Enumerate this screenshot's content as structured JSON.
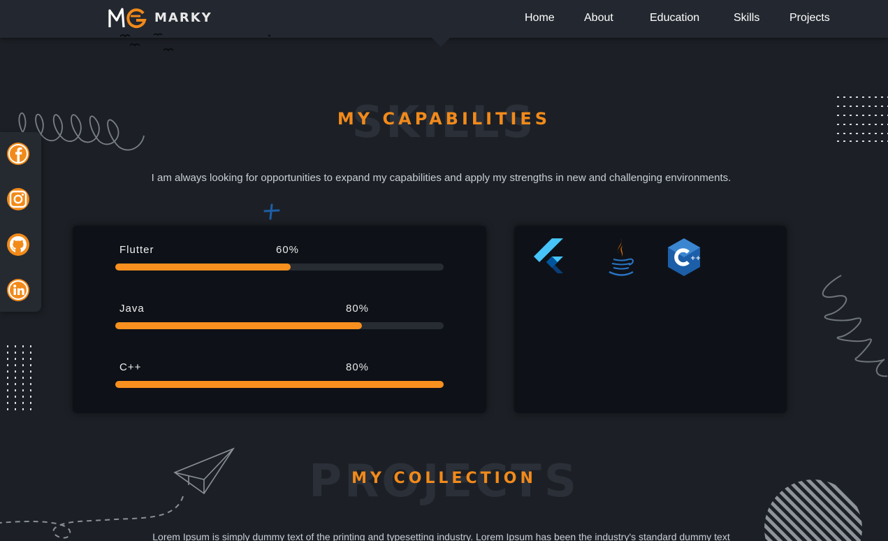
{
  "brand": {
    "name": "MARKY",
    "logo_letters": "MG"
  },
  "nav": {
    "items": [
      "Home",
      "About",
      "Education",
      "Skills",
      "Projects"
    ]
  },
  "social": [
    {
      "name": "facebook-icon"
    },
    {
      "name": "instagram-icon"
    },
    {
      "name": "github-icon"
    },
    {
      "name": "linkedin-icon"
    }
  ],
  "skills_section": {
    "watermark": "SKILLS",
    "title": "MY CAPABILITIES",
    "description": "I am always looking for opportunities to expand my capabilities and apply my strengths in new and challenging environments.",
    "items": [
      {
        "name": "Flutter",
        "percent_label": "60%",
        "fill": 0.535
      },
      {
        "name": "Java",
        "percent_label": "80%",
        "fill": 0.75
      },
      {
        "name": "C++",
        "percent_label": "80%",
        "fill": 1.0
      }
    ],
    "tech_icons": [
      "flutter-icon",
      "java-icon",
      "cplusplus-icon"
    ]
  },
  "projects_section": {
    "watermark": "PROJECTS",
    "title": "MY COLLECTION",
    "description": "Lorem Ipsum is simply dummy text of the printing and typesetting industry. Lorem Ipsum has been the industry's standard dummy text"
  },
  "colors": {
    "accent": "#f28a1a",
    "background": "#1c2026",
    "card": "#0e1218",
    "nav": "#232830"
  }
}
